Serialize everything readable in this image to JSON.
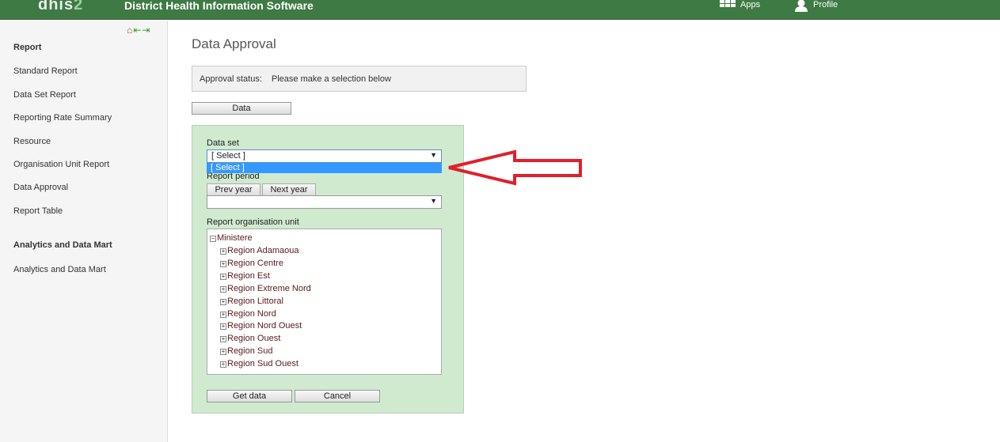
{
  "header": {
    "logo_text": "dhis",
    "logo_num": "2",
    "title": "District Health Information Software",
    "apps": "Apps",
    "profile": "Profile",
    "color": "#3e7a44"
  },
  "sidebar": {
    "sections": [
      {
        "heading": "Report",
        "items": [
          "Standard Report",
          "Data Set Report",
          "Reporting Rate Summary",
          "Resource",
          "Organisation Unit Report",
          "Data Approval",
          "Report Table"
        ]
      },
      {
        "heading": "Analytics and Data Mart",
        "items": [
          "Analytics and Data Mart"
        ]
      }
    ]
  },
  "main": {
    "title": "Data Approval",
    "status_label": "Approval status:",
    "status_value": "Please make a selection below",
    "data_button": "Data",
    "dataset_label": "Data set",
    "dataset_value": "[ Select ]",
    "dataset_option": "[ Select ]",
    "period_label": "Report period",
    "prev_year": "Prev year",
    "next_year": "Next year",
    "period_value": "",
    "orgunit_label": "Report organisation unit",
    "tree_root": "Ministere",
    "tree_children": [
      "Region Adamaoua",
      "Region Centre",
      "Region Est",
      "Region Extreme Nord",
      "Region Littoral",
      "Region Nord",
      "Region Nord Ouest",
      "Region Ouest",
      "Region Sud",
      "Region Sud Ouest"
    ],
    "get_data": "Get data",
    "cancel": "Cancel"
  },
  "annotation": {
    "arrow_color": "#e0202a"
  }
}
